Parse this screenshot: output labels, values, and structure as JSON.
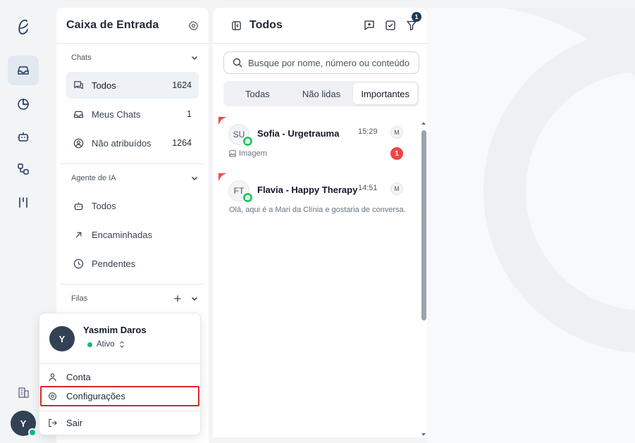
{
  "rail": {
    "logo": "e-script-logo",
    "items": [
      {
        "name": "inbox",
        "icon": "inbox-icon",
        "active": true
      },
      {
        "name": "reports",
        "icon": "pie-chart-icon",
        "active": false
      },
      {
        "name": "bots",
        "icon": "bot-icon",
        "active": false
      },
      {
        "name": "flows",
        "icon": "flow-icon",
        "active": false
      },
      {
        "name": "kanban",
        "icon": "kanban-icon",
        "active": false
      }
    ],
    "org_icon": "building-icon",
    "avatar_initial": "Y",
    "avatar_status_color": "#10b981"
  },
  "inbox": {
    "title": "Caixa de Entrada",
    "settings_icon": "gear-icon",
    "sections": {
      "chats": {
        "label": "Chats",
        "items": [
          {
            "label": "Todos",
            "count": "1624",
            "icon": "chats-icon",
            "active": true
          },
          {
            "label": "Meus Chats",
            "count": "1",
            "icon": "inbox-icon",
            "active": false
          },
          {
            "label": "Não atribuídos",
            "count": "1264",
            "icon": "user-circle-icon",
            "active": false
          }
        ]
      },
      "ai": {
        "label": "Agente de IA",
        "items": [
          {
            "label": "Todos",
            "icon": "bot-icon"
          },
          {
            "label": "Encaminhadas",
            "icon": "arrow-up-right-icon"
          },
          {
            "label": "Pendentes",
            "icon": "clock-icon"
          }
        ]
      },
      "queues": {
        "label": "Filas"
      }
    }
  },
  "chatlist": {
    "title": "Todos",
    "filter_badge": "1",
    "search_placeholder": "Busque por nome, número ou conteúdo",
    "tabs": [
      {
        "label": "Todas",
        "active": false
      },
      {
        "label": "Não lidas",
        "active": false
      },
      {
        "label": "Importantes",
        "active": true
      }
    ],
    "conversations": [
      {
        "initials": "SU",
        "name": "Sofia - Urgetrauma",
        "time": "15:29",
        "assignee": "M",
        "preview": "Imagem",
        "unread": "1"
      },
      {
        "initials": "FT",
        "name": "Flavia - Happy Therapy",
        "time": "14:51",
        "assignee": "M",
        "preview": "Olá, aqui é a Mari da Clínia e gostaria de conversa..."
      }
    ]
  },
  "user_menu": {
    "initial": "Y",
    "name": "Yasmim Daros",
    "status": "Ativo",
    "status_color": "#10b981",
    "items": [
      {
        "label": "Conta",
        "icon": "user-icon"
      },
      {
        "label": "Configurações",
        "icon": "gear-icon",
        "highlighted": true
      },
      {
        "label": "Sair",
        "icon": "logout-icon"
      }
    ]
  },
  "colors": {
    "accent_dark": "#334155",
    "highlight_red": "#dc2626",
    "unread_red": "#ef4444",
    "whatsapp_green": "#22c55e"
  }
}
